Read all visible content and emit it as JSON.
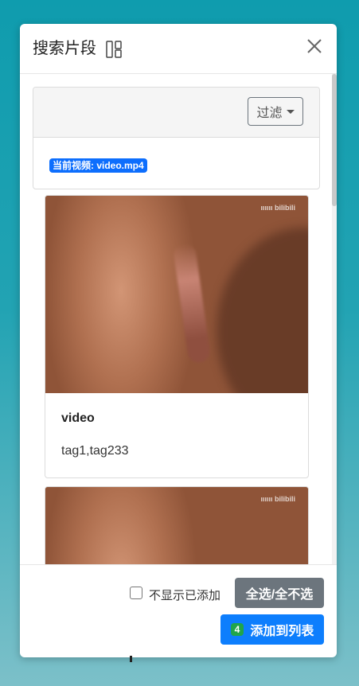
{
  "modal": {
    "title": "搜索片段",
    "close_icon": "close-icon",
    "layout_icon": "layout-toggle-icon"
  },
  "filter": {
    "button_label": "过滤",
    "current_video_label": "当前视频: video.mp4"
  },
  "clips": [
    {
      "title": "video",
      "tags": "tag1,tag233",
      "watermark": "ıııııı bilibili"
    },
    {
      "title": "",
      "tags": "",
      "watermark": "ıııııı bilibili"
    }
  ],
  "footer": {
    "hide_added_label": "不显示已添加",
    "hide_added_checked": false,
    "select_all_label": "全选/全不选",
    "add_to_list_label": "添加到列表",
    "selected_count": "4"
  },
  "colors": {
    "primary": "#0d7efd",
    "secondary": "#6c757d",
    "success": "#20a54a"
  }
}
